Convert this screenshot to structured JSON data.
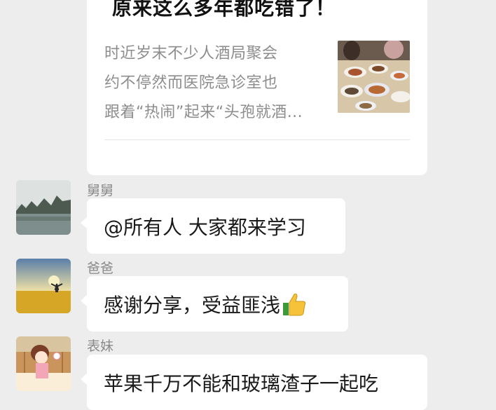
{
  "article": {
    "title": "原来这么多年都吃错了！",
    "desc_lines": [
      "时近岁末不少人酒局聚会",
      "约不停然而医院急诊室也",
      "跟着“热闹”起来“头孢就酒..."
    ]
  },
  "messages": [
    {
      "sender": "舅舅",
      "text": "@所有人 大家都来学习"
    },
    {
      "sender": "爸爸",
      "text": "感谢分享，受益匪浅",
      "emoji": "thumbs-up-icon"
    },
    {
      "sender": "表妹",
      "text": "苹果千万不能和玻璃渣子一起吃"
    }
  ]
}
